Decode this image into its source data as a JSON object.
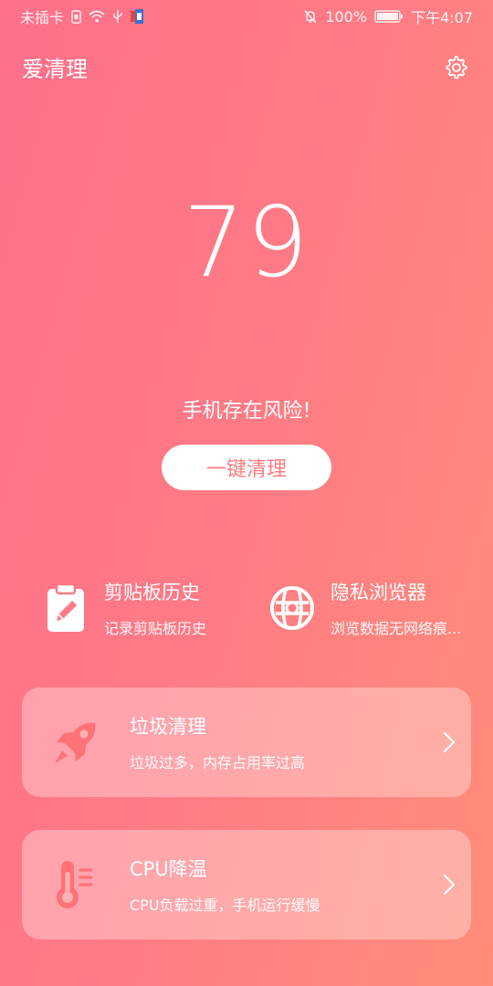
{
  "status_bar": {
    "carrier": "未插卡",
    "battery": "100%",
    "time": "下午4:07"
  },
  "header": {
    "title": "爱清理"
  },
  "score": {
    "value": "79",
    "risk_text": "手机存在风险!",
    "clean_button": "一键清理"
  },
  "features": [
    {
      "title": "剪贴板历史",
      "subtitle": "记录剪贴板历史",
      "icon": "clipboard-edit-icon"
    },
    {
      "title": "隐私浏览器",
      "subtitle": "浏览数据无网络痕...",
      "icon": "browser-globe-icon"
    }
  ],
  "cards": [
    {
      "title": "垃圾清理",
      "subtitle": "垃圾过多，内存占用率过高",
      "icon": "rocket-icon"
    },
    {
      "title": "CPU降温",
      "subtitle": "CPU负载过重，手机运行缓慢",
      "icon": "thermometer-icon"
    }
  ],
  "colors": {
    "background_start": "#ff6f8a",
    "background_end": "#ff8d79",
    "accent_icon": "#ff7278"
  }
}
